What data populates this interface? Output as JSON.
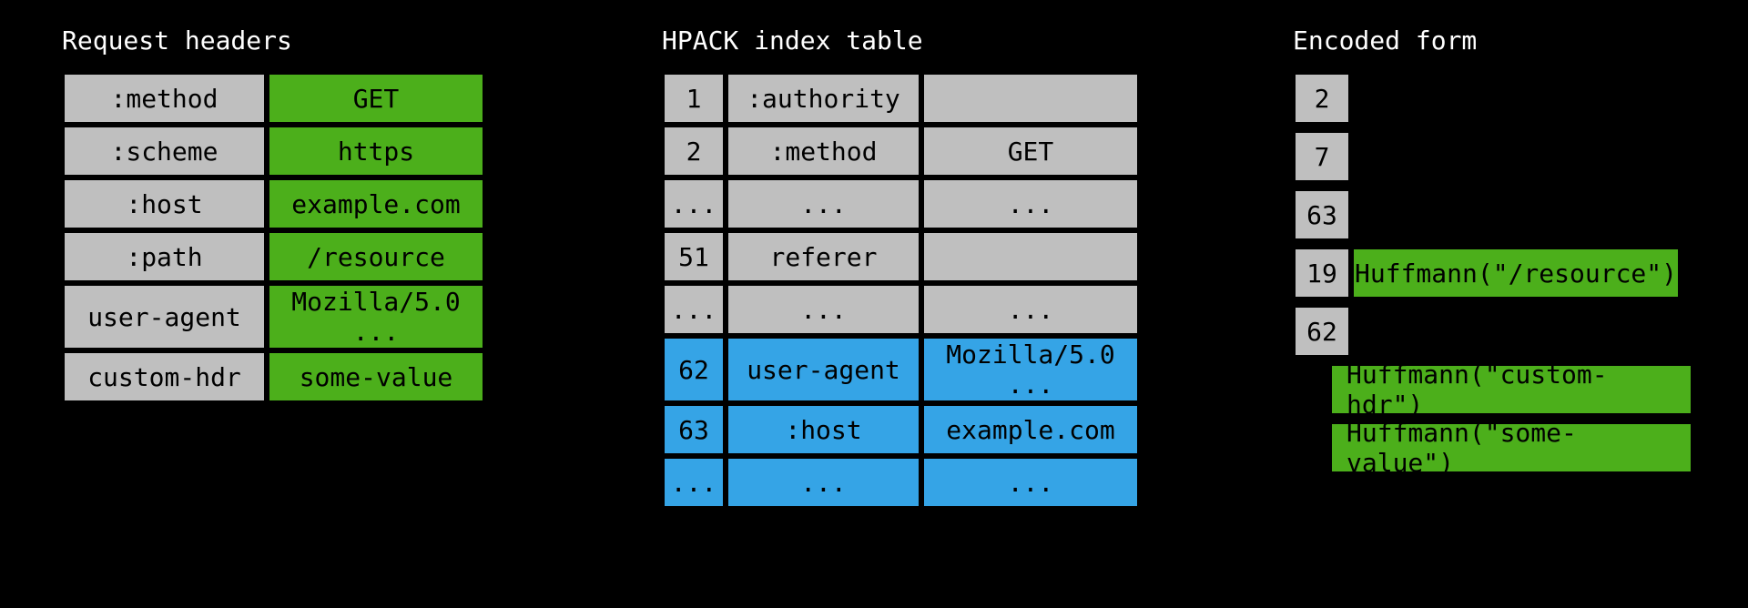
{
  "headings": {
    "request": "Request headers",
    "index": "HPACK index table",
    "encoded": "Encoded form"
  },
  "request_headers": [
    {
      "name": ":method",
      "value": "GET"
    },
    {
      "name": ":scheme",
      "value": "https"
    },
    {
      "name": ":host",
      "value": "example.com"
    },
    {
      "name": ":path",
      "value": "/resource"
    },
    {
      "name": "user-agent",
      "value": "Mozilla/5.0 ..."
    },
    {
      "name": "custom-hdr",
      "value": "some-value"
    }
  ],
  "index_table": {
    "static": [
      {
        "idx": "1",
        "name": ":authority",
        "value": ""
      },
      {
        "idx": "2",
        "name": ":method",
        "value": "GET"
      },
      {
        "idx": "...",
        "name": "...",
        "value": "..."
      },
      {
        "idx": "51",
        "name": "referer",
        "value": ""
      },
      {
        "idx": "...",
        "name": "...",
        "value": "..."
      }
    ],
    "dynamic": [
      {
        "idx": "62",
        "name": "user-agent",
        "value": "Mozilla/5.0 ..."
      },
      {
        "idx": "63",
        "name": ":host",
        "value": "example.com"
      },
      {
        "idx": "...",
        "name": "...",
        "value": "..."
      }
    ]
  },
  "encoded": {
    "nums": [
      "2",
      "7",
      "63",
      "19",
      "62"
    ],
    "huff_path": "Huffmann(\"/resource\")",
    "huff_hdr": "Huffmann(\"custom-hdr\")",
    "huff_val": "Huffmann(\"some-value\")"
  }
}
